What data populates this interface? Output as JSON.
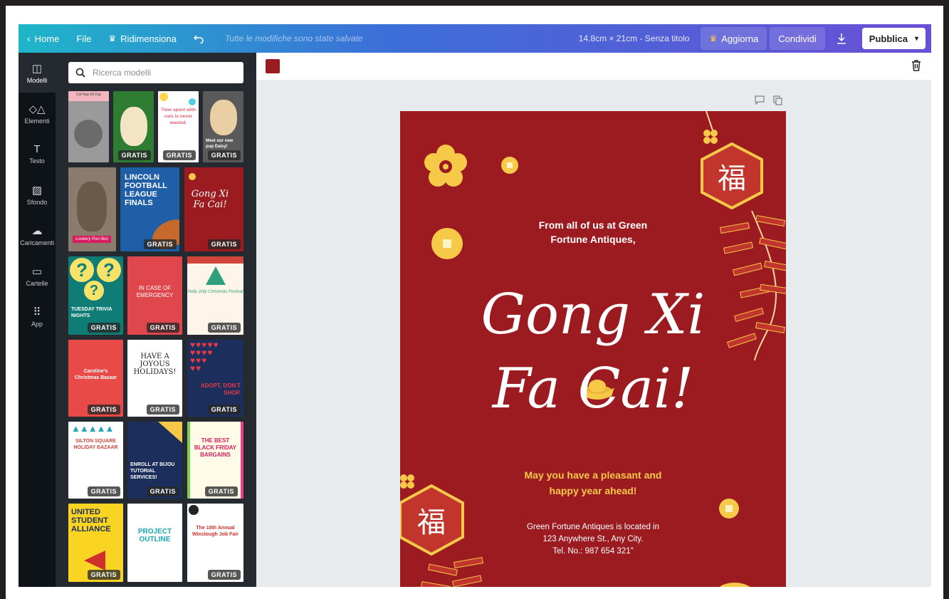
{
  "topbar": {
    "home": "Home",
    "file": "File",
    "resize": "Ridimensiona",
    "saved_status": "Tutte le modifiche sono state salvate",
    "doc_info": "14.8cm × 21cm - Senza titolo",
    "upgrade": "Aggiorna",
    "share": "Condividi",
    "publish": "Pubblica"
  },
  "rail": {
    "items": [
      {
        "label": "Modelli",
        "icon": "layout-icon"
      },
      {
        "label": "Elementi",
        "icon": "shapes-icon"
      },
      {
        "label": "Testo",
        "icon": "text-icon"
      },
      {
        "label": "Sfondo",
        "icon": "background-icon"
      },
      {
        "label": "Caricamenti",
        "icon": "upload-icon"
      },
      {
        "label": "Cartelle",
        "icon": "folder-icon"
      },
      {
        "label": "App",
        "icon": "apps-icon"
      }
    ]
  },
  "panel": {
    "search_placeholder": "Ricerca modelli",
    "badge": "GRATIS",
    "templates": [
      {
        "text": "Cat Nap All Day"
      },
      {
        "text": ""
      },
      {
        "text": "Time spent with cats is never wasted."
      },
      {
        "text": "Meet our new pup Daisy!"
      },
      {
        "text": "Lookery Purr-fect"
      },
      {
        "text": "LINCOLN FOOTBALL LEAGUE FINALS"
      },
      {
        "text": "Gong Xi Fa Cai!"
      },
      {
        "text": "TUESDAY TRIVIA NIGHTS"
      },
      {
        "text": "IN CASE OF EMERGENCY"
      },
      {
        "text": "Holly Jolly Christmas Festival"
      },
      {
        "text": "Caroline's Christmas Bazaar"
      },
      {
        "text": "HAVE A JOYOUS HOLIDAYS!"
      },
      {
        "text": "ADOPT, DON'T SHOP."
      },
      {
        "text": "SILTON SQUARE HOLIDAY BAZAAR"
      },
      {
        "text": "ENROLL AT BIJOU TUTORIAL SERVICES!"
      },
      {
        "text": "THE BEST BLACK FRIDAY BARGAINS"
      },
      {
        "text": "UNITED STUDENT ALLIANCE"
      },
      {
        "text": "PROJECT OUTLINE"
      },
      {
        "text": "The 10th Annual Winslough Job Fair"
      }
    ]
  },
  "design": {
    "from": "From all of us at Green Fortune Antiques,",
    "title_line1": "Gong Xi",
    "title_line2": "Fa Cai!",
    "wish": "May you have a pleasant and happy year ahead!",
    "address_line1": "Green Fortune Antiques is located in",
    "address_line2": "123 Anywhere St., Any City.",
    "address_line3": "Tel. No.: 987 654 321\"",
    "fu_char": "福"
  },
  "colors": {
    "design_red": "#9b1b21",
    "gold": "#f7c948",
    "swatch": "#9a1c20"
  }
}
